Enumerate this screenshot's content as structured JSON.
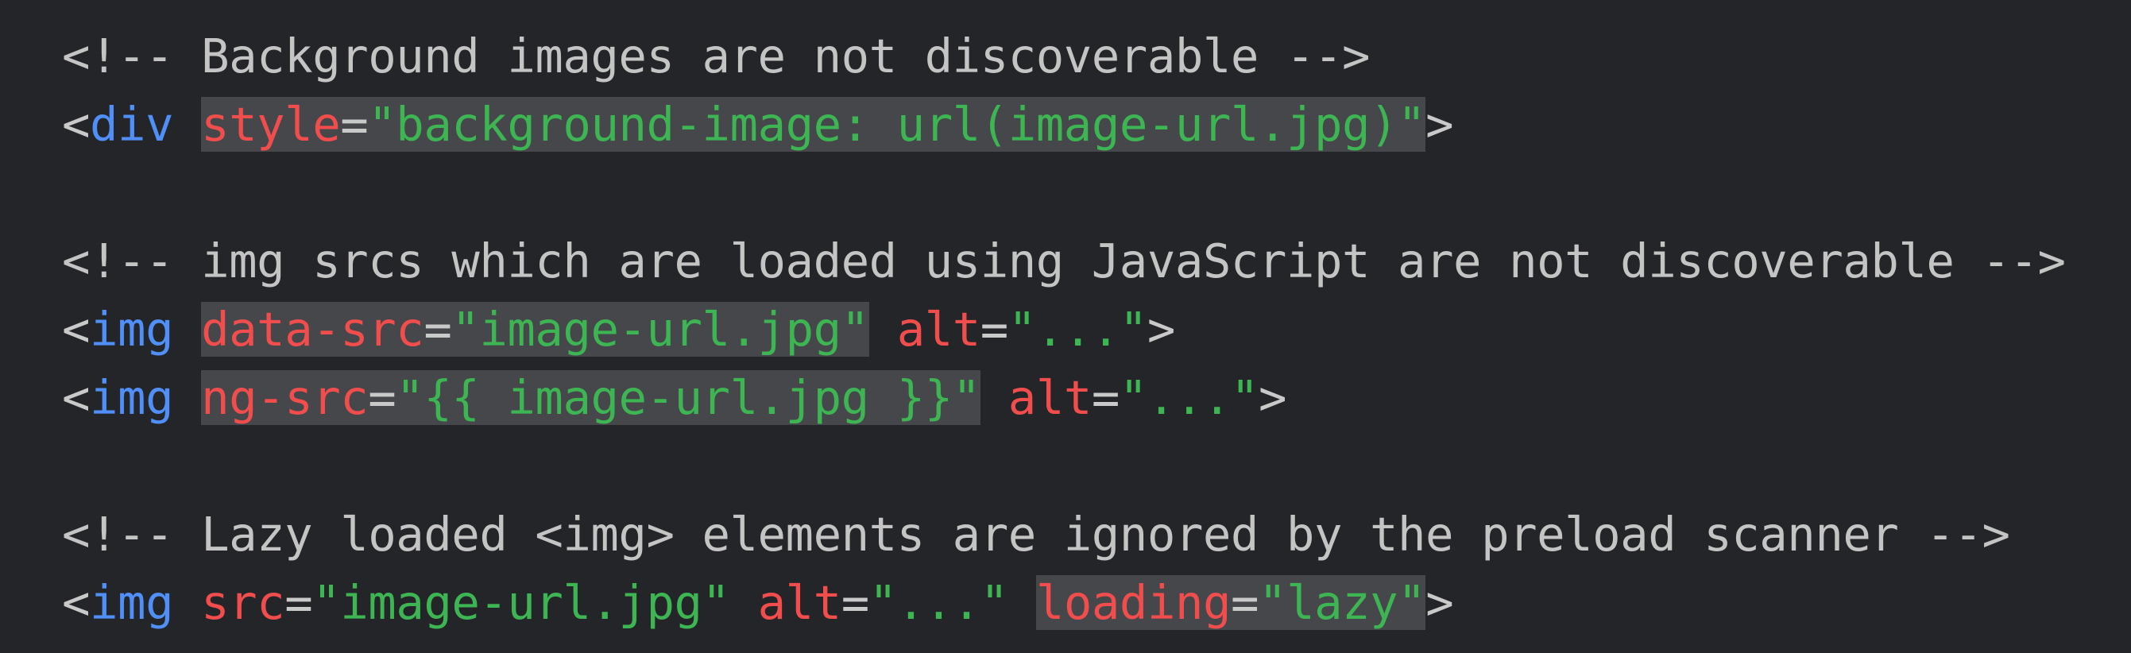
{
  "lines": [
    {
      "tokens": [
        {
          "text": "<!-- Background images are not discoverable -->",
          "kind": "comment",
          "hl": false
        }
      ]
    },
    {
      "tokens": [
        {
          "text": "<",
          "kind": "punct",
          "hl": false
        },
        {
          "text": "div",
          "kind": "tag",
          "hl": false
        },
        {
          "text": " ",
          "kind": "punct",
          "hl": false
        },
        {
          "text": "style",
          "kind": "attr",
          "hl": true
        },
        {
          "text": "=",
          "kind": "punct",
          "hl": true
        },
        {
          "text": "\"background-image: url(image-url.jpg)\"",
          "kind": "value",
          "hl": true
        },
        {
          "text": ">",
          "kind": "punct",
          "hl": false
        }
      ]
    },
    {
      "tokens": []
    },
    {
      "tokens": [
        {
          "text": "<!-- img srcs which are loaded using JavaScript are not discoverable -->",
          "kind": "comment",
          "hl": false
        }
      ]
    },
    {
      "tokens": [
        {
          "text": "<",
          "kind": "punct",
          "hl": false
        },
        {
          "text": "img",
          "kind": "tag",
          "hl": false
        },
        {
          "text": " ",
          "kind": "punct",
          "hl": false
        },
        {
          "text": "data-src",
          "kind": "attr",
          "hl": true
        },
        {
          "text": "=",
          "kind": "punct",
          "hl": true
        },
        {
          "text": "\"image-url.jpg\"",
          "kind": "value",
          "hl": true
        },
        {
          "text": " ",
          "kind": "punct",
          "hl": false
        },
        {
          "text": "alt",
          "kind": "attr",
          "hl": false
        },
        {
          "text": "=",
          "kind": "punct",
          "hl": false
        },
        {
          "text": "\"...\"",
          "kind": "value",
          "hl": false
        },
        {
          "text": ">",
          "kind": "punct",
          "hl": false
        }
      ]
    },
    {
      "tokens": [
        {
          "text": "<",
          "kind": "punct",
          "hl": false
        },
        {
          "text": "img",
          "kind": "tag",
          "hl": false
        },
        {
          "text": " ",
          "kind": "punct",
          "hl": false
        },
        {
          "text": "ng-src",
          "kind": "attr",
          "hl": true
        },
        {
          "text": "=",
          "kind": "punct",
          "hl": true
        },
        {
          "text": "\"{{ image-url.jpg }}\"",
          "kind": "value",
          "hl": true
        },
        {
          "text": " ",
          "kind": "punct",
          "hl": false
        },
        {
          "text": "alt",
          "kind": "attr",
          "hl": false
        },
        {
          "text": "=",
          "kind": "punct",
          "hl": false
        },
        {
          "text": "\"...\"",
          "kind": "value",
          "hl": false
        },
        {
          "text": ">",
          "kind": "punct",
          "hl": false
        }
      ]
    },
    {
      "tokens": []
    },
    {
      "tokens": [
        {
          "text": "<!-- Lazy loaded <img> elements are ignored by the preload scanner -->",
          "kind": "comment",
          "hl": false
        }
      ]
    },
    {
      "tokens": [
        {
          "text": "<",
          "kind": "punct",
          "hl": false
        },
        {
          "text": "img",
          "kind": "tag",
          "hl": false
        },
        {
          "text": " ",
          "kind": "punct",
          "hl": false
        },
        {
          "text": "src",
          "kind": "attr",
          "hl": false
        },
        {
          "text": "=",
          "kind": "punct",
          "hl": false
        },
        {
          "text": "\"image-url.jpg\"",
          "kind": "value",
          "hl": false
        },
        {
          "text": " ",
          "kind": "punct",
          "hl": false
        },
        {
          "text": "alt",
          "kind": "attr",
          "hl": false
        },
        {
          "text": "=",
          "kind": "punct",
          "hl": false
        },
        {
          "text": "\"...\"",
          "kind": "value",
          "hl": false
        },
        {
          "text": " ",
          "kind": "punct",
          "hl": false
        },
        {
          "text": "loading",
          "kind": "attr",
          "hl": true
        },
        {
          "text": "=",
          "kind": "punct",
          "hl": true
        },
        {
          "text": "\"lazy\"",
          "kind": "value",
          "hl": true
        },
        {
          "text": ">",
          "kind": "punct",
          "hl": false
        }
      ]
    }
  ],
  "colors": {
    "background": "#242528",
    "comment": "#c4c4c4",
    "punct": "#c9c9c9",
    "tag": "#4f8ff7",
    "attr": "#f24d4d",
    "value": "#3db553",
    "highlight": "#45474b"
  }
}
